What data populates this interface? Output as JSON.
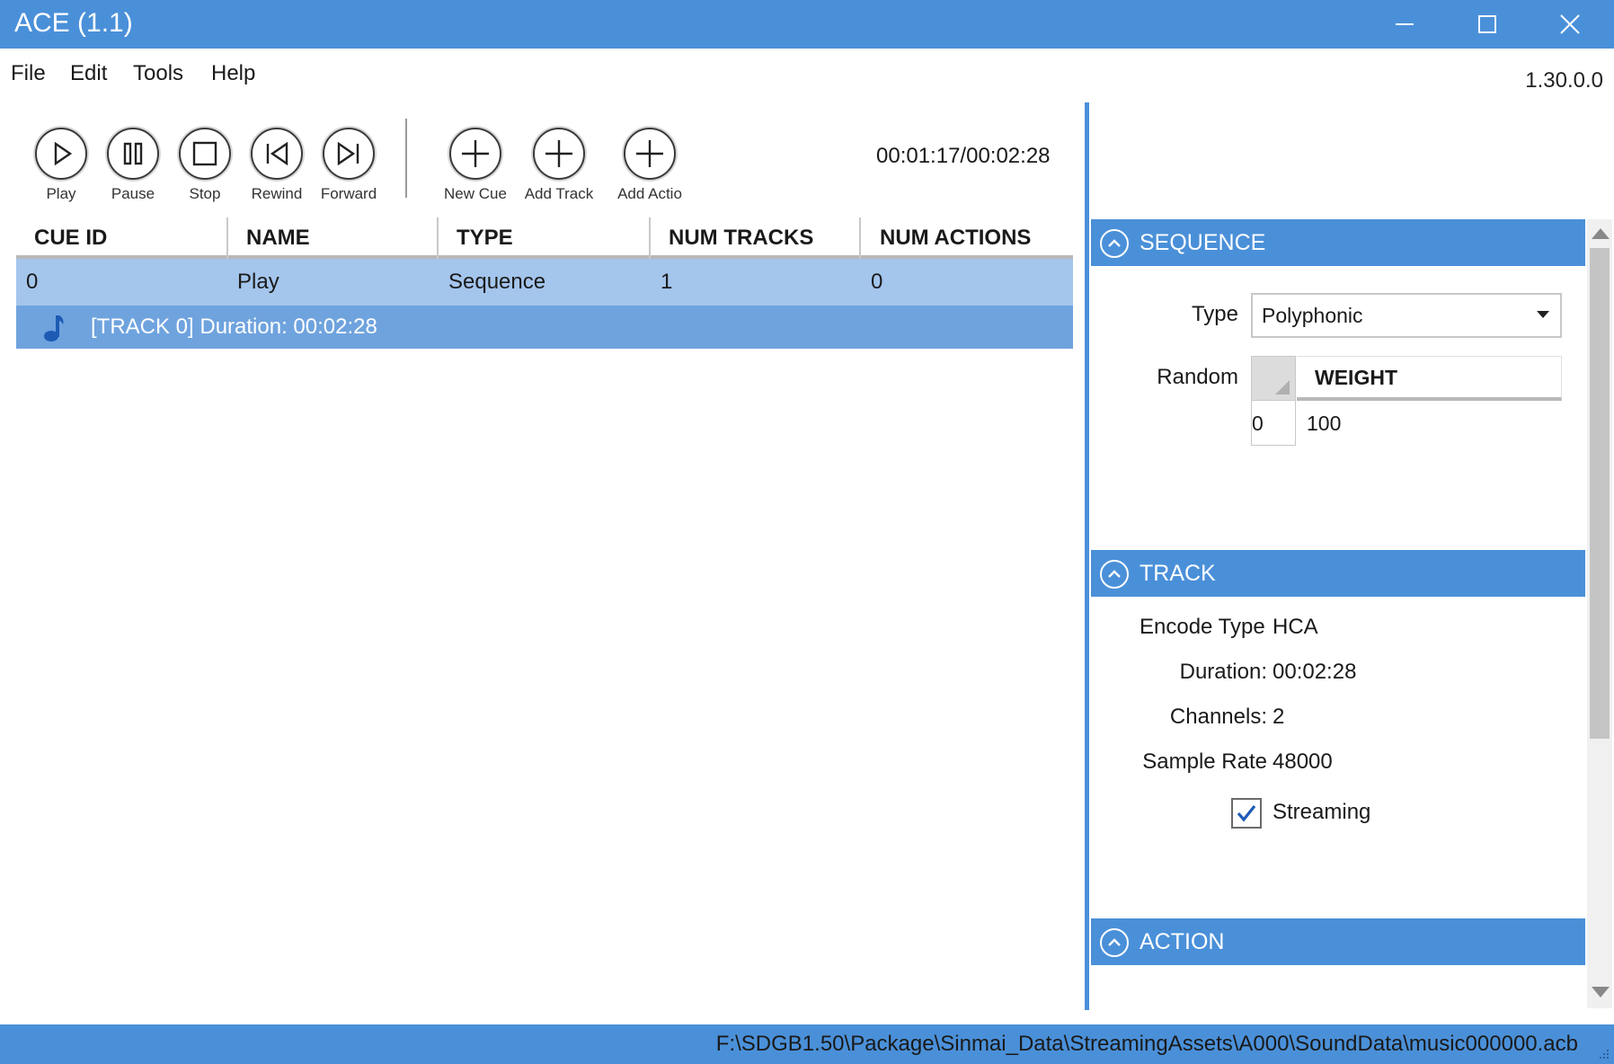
{
  "window": {
    "title": "ACE (1.1)"
  },
  "menu": {
    "items": [
      "File",
      "Edit",
      "Tools",
      "Help"
    ],
    "version": "1.30.0.0"
  },
  "toolbar": {
    "play": "Play",
    "pause": "Pause",
    "stop": "Stop",
    "rewind": "Rewind",
    "forward": "Forward",
    "new_cue": "New Cue",
    "add_track": "Add Track",
    "add_action": "Add Actio",
    "timecode": "00:01:17/00:02:28"
  },
  "cue_grid": {
    "columns": [
      "CUE ID",
      "NAME",
      "TYPE",
      "NUM TRACKS",
      "NUM ACTIONS"
    ],
    "rows": [
      {
        "cue_id": "0",
        "name": "Play",
        "type": "Sequence",
        "num_tracks": "1",
        "num_actions": "0"
      }
    ],
    "track_row": "[TRACK 0] Duration: 00:02:28"
  },
  "sequence": {
    "header": "SEQUENCE",
    "type_label": "Type",
    "type_value": "Polyphonic",
    "random_label": "Random",
    "weight_header": "WEIGHT",
    "weight_index": "0",
    "weight_value": "100"
  },
  "track": {
    "header": "TRACK",
    "encode_type_label": "Encode Type",
    "encode_type_value": "HCA",
    "duration_label": "Duration:",
    "duration_value": "00:02:28",
    "channels_label": "Channels:",
    "channels_value": "2",
    "sample_rate_label": "Sample Rate",
    "sample_rate_value": "48000",
    "streaming_label": "Streaming",
    "streaming_checked": true
  },
  "action": {
    "header": "ACTION"
  },
  "status": {
    "path": "F:\\SDGB1.50\\Package\\Sinmai_Data\\StreamingAssets\\A000\\SoundData\\music000000.acb"
  },
  "colors": {
    "accent": "#4a90d9",
    "row_selected": "#a4c5ec",
    "track_row": "#6fa3de",
    "check": "#1d5bb5"
  }
}
